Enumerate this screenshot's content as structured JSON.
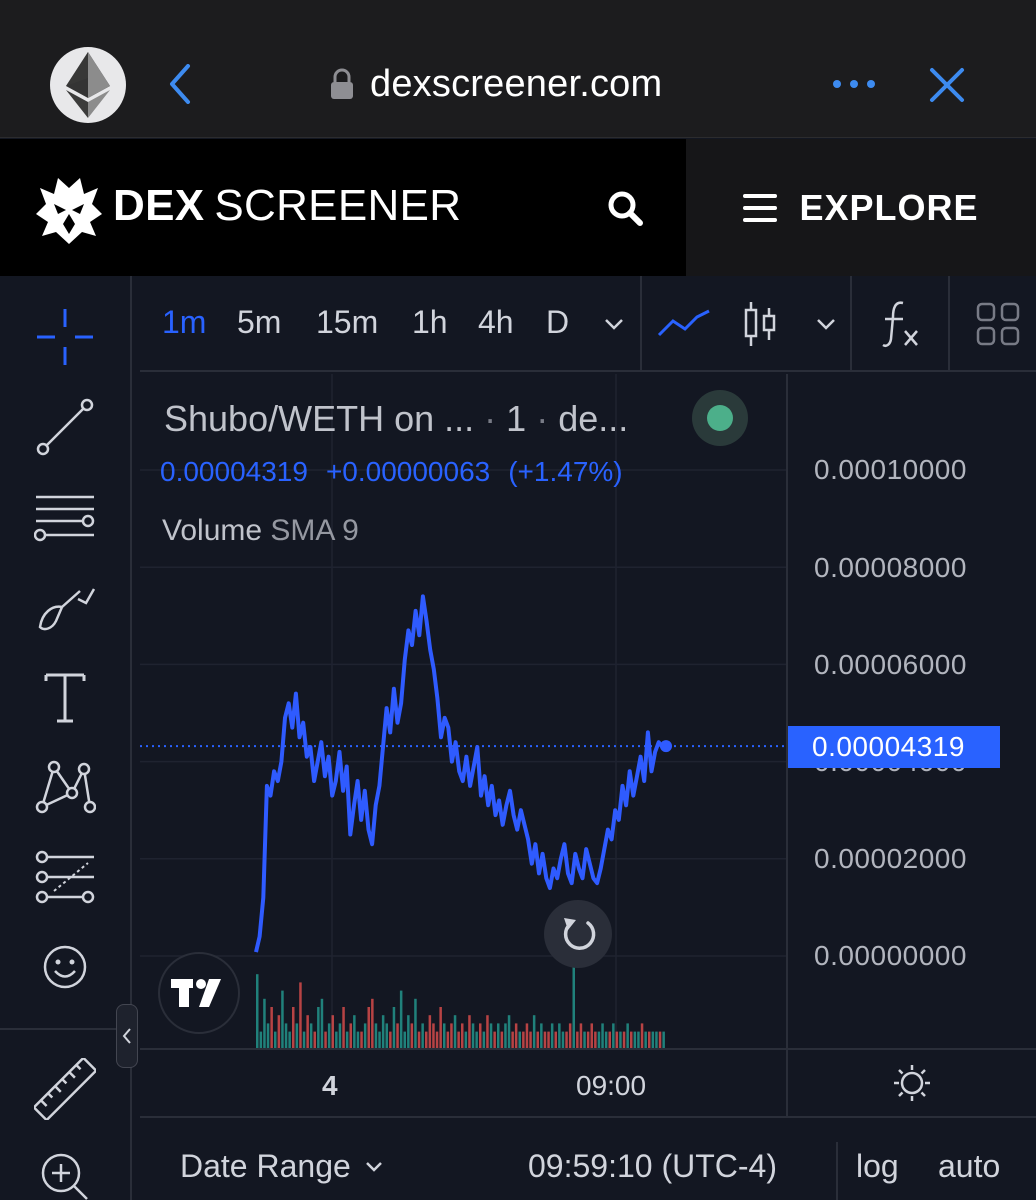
{
  "browser": {
    "url": "dexscreener.com",
    "favicon_icon": "ethereum-icon",
    "accent": "#3d8bf0"
  },
  "site": {
    "brand_bold": "DEX",
    "brand_rest": "SCREENER",
    "explore_label": "EXPLORE"
  },
  "toolbar": {
    "timeframes": [
      "1m",
      "5m",
      "15m",
      "1h",
      "4h",
      "D"
    ],
    "active_timeframe": "1m"
  },
  "legend": {
    "pair": "Shubo/WETH on ...",
    "interval": "1",
    "exchange": "de...",
    "price": "0.00004319",
    "change": "+0.00000063",
    "change_pct": "(+1.47%)",
    "volume_label": "Volume",
    "volume_indicator": "SMA 9",
    "status_color": "#4caf8a"
  },
  "price_scale": {
    "labels": [
      "0.00010000",
      "0.00008000",
      "0.00006000",
      "0.00004000",
      "0.00002000",
      "0.00000000"
    ],
    "current_price_label": "0.00004319"
  },
  "time_axis": {
    "labels": [
      "4",
      "09:00"
    ]
  },
  "bottom_bar": {
    "date_range": "Date Range",
    "clock": "09:59:10 (UTC-4)",
    "log": "log",
    "auto": "auto"
  },
  "colors": {
    "line": "#2f5bff",
    "accent": "#2962ff",
    "background": "#131722",
    "vol_up": "#26a69a",
    "vol_down": "#ef5350"
  },
  "chart_data": {
    "type": "line",
    "ylim": [
      0,
      0.0001
    ],
    "current_price": 4.319e-05,
    "y": [
      8e-07,
      4e-06,
      1.2e-05,
      3.5e-05,
      3.3e-05,
      3.8e-05,
      3.6e-05,
      4e-05,
      4.9e-05,
      5.2e-05,
      4.7e-05,
      5.4e-05,
      4.5e-05,
      4.8e-05,
      4.1e-05,
      4.3e-05,
      3.6e-05,
      4e-05,
      4.4e-05,
      3.7e-05,
      4.1e-05,
      3.3e-05,
      3.6e-05,
      4.2e-05,
      3.4e-05,
      3.9e-05,
      2.5e-05,
      3.1e-05,
      3.6e-05,
      2.8e-05,
      3.4e-05,
      2.6e-05,
      2.3e-05,
      3.1e-05,
      3.5e-05,
      4.3e-05,
      5.1e-05,
      4.6e-05,
      5.5e-05,
      4.8e-05,
      5.2e-05,
      6.1e-05,
      6.7e-05,
      6.4e-05,
      7.1e-05,
      6.6e-05,
      7.4e-05,
      6.9e-05,
      6.3e-05,
      5.9e-05,
      5.3e-05,
      4.5e-05,
      4.9e-05,
      4.7e-05,
      4e-05,
      4.4e-05,
      3.8e-05,
      3.6e-05,
      4.1e-05,
      3.5e-05,
      3.9e-05,
      4.3e-05,
      3.3e-05,
      3.7e-05,
      3.1e-05,
      3.5e-05,
      2.9e-05,
      3.2e-05,
      2.7e-05,
      3.1e-05,
      3.4e-05,
      2.9e-05,
      2.6e-05,
      3e-05,
      2.7e-05,
      2.4e-05,
      1.9e-05,
      2.3e-05,
      1.7e-05,
      2.1e-05,
      1.6e-05,
      1.4e-05,
      1.8e-05,
      1.6e-05,
      2e-05,
      2.3e-05,
      1.7e-05,
      1.5e-05,
      2.1e-05,
      1.8e-05,
      1.6e-05,
      2.2e-05,
      1.9e-05,
      1.6e-05,
      1.5e-05,
      1.8e-05,
      2.2e-05,
      2.6e-05,
      2.4e-05,
      3e-05,
      2.8e-05,
      3.5e-05,
      3.1e-05,
      3.8e-05,
      3.3e-05,
      3.7e-05,
      4.1e-05,
      3.6e-05,
      4.6e-05,
      3.8e-05,
      4.2e-05,
      4.4e-05,
      4.3e-05,
      4.319e-05
    ],
    "volume": [
      0.9,
      0.2,
      0.6,
      0.3,
      0.5,
      0.2,
      0.4,
      0.7,
      0.3,
      0.2,
      0.5,
      0.3,
      0.8,
      0.2,
      0.4,
      0.3,
      0.2,
      0.5,
      0.6,
      0.2,
      0.3,
      0.4,
      0.2,
      0.3,
      0.5,
      0.2,
      0.3,
      0.4,
      0.2,
      0.2,
      0.3,
      0.5,
      0.6,
      0.3,
      0.2,
      0.4,
      0.3,
      0.2,
      0.5,
      0.3,
      0.7,
      0.2,
      0.4,
      0.3,
      0.6,
      0.2,
      0.3,
      0.2,
      0.4,
      0.3,
      0.2,
      0.5,
      0.3,
      0.2,
      0.3,
      0.4,
      0.2,
      0.3,
      0.2,
      0.4,
      0.3,
      0.2,
      0.3,
      0.2,
      0.4,
      0.3,
      0.2,
      0.3,
      0.2,
      0.3,
      0.4,
      0.2,
      0.3,
      0.2,
      0.2,
      0.3,
      0.2,
      0.4,
      0.2,
      0.3,
      0.2,
      0.2,
      0.3,
      0.2,
      0.3,
      0.2,
      0.2,
      0.3,
      1.0,
      0.2,
      0.3,
      0.2,
      0.2,
      0.3,
      0.2,
      0.2,
      0.3,
      0.2,
      0.2,
      0.3,
      0.2,
      0.2,
      0.2,
      0.3,
      0.2,
      0.2,
      0.2,
      0.3,
      0.2,
      0.2,
      0.2,
      0.2,
      0.2,
      0.2
    ]
  }
}
